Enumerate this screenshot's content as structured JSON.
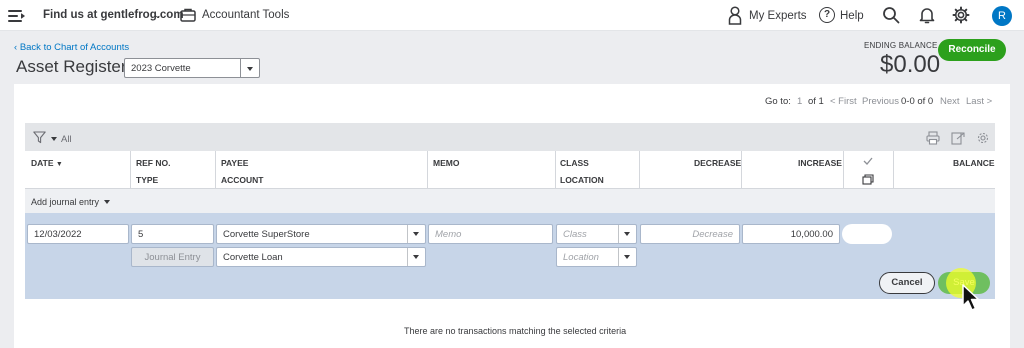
{
  "topbar": {
    "company": "Find us at gentlefrog.com",
    "accountant_tools": "Accountant Tools",
    "my_experts": "My Experts",
    "help": "Help",
    "avatar_initial": "R"
  },
  "header": {
    "back_link": "Back to Chart of Accounts",
    "title": "Asset Register",
    "account_selected": "2023 Corvette",
    "ending_balance_label": "ENDING BALANCE",
    "ending_balance": "$0.00",
    "reconcile": "Reconcile"
  },
  "pager": {
    "go_to": "Go to:",
    "page": "1",
    "of": "of 1",
    "first": "< First",
    "previous": "Previous",
    "range": "0-0 of 0",
    "next": "Next",
    "last": "Last >"
  },
  "filter": {
    "label": "All"
  },
  "columns": {
    "date": "DATE",
    "ref_no": "REF NO.",
    "type": "TYPE",
    "payee": "PAYEE",
    "account": "ACCOUNT",
    "memo": "MEMO",
    "class": "CLASS",
    "location": "LOCATION",
    "decrease": "DECREASE",
    "increase": "INCREASE",
    "balance": "BALANCE"
  },
  "add_journal": "Add journal entry",
  "entry": {
    "date": "12/03/2022",
    "ref_no": "5",
    "type": "Journal Entry",
    "payee": "Corvette SuperStore",
    "account": "Corvette Loan",
    "memo_placeholder": "Memo",
    "class_placeholder": "Class",
    "location_placeholder": "Location",
    "decrease_placeholder": "Decrease",
    "increase": "10,000.00"
  },
  "buttons": {
    "cancel": "Cancel",
    "save": "Save"
  },
  "empty_message": "There are no transactions matching the selected criteria",
  "colors": {
    "brand_green": "#2ca01c",
    "link_blue": "#0077c5",
    "edit_row": "#c7d5e8"
  },
  "icons": [
    "hamburger-icon",
    "briefcase-icon",
    "person-icon",
    "help-icon",
    "search-icon",
    "bell-icon",
    "gear-icon",
    "filter-icon",
    "print-icon",
    "export-icon",
    "settings-icon",
    "check-icon",
    "copy-icon",
    "mouse-pointer-icon"
  ]
}
